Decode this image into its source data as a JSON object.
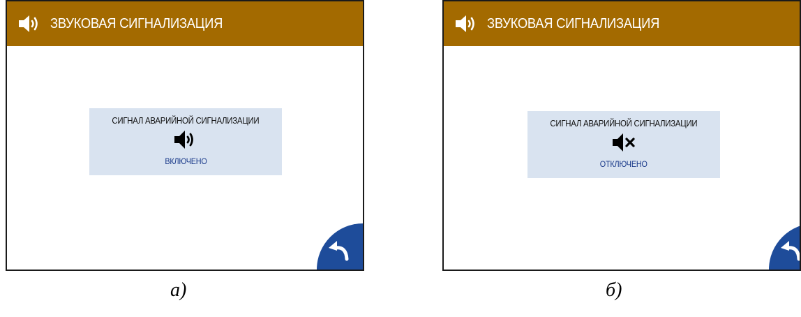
{
  "screens": [
    {
      "header": {
        "title": "ЗВУКОВАЯ СИГНАЛИЗАЦИЯ",
        "icon": "speaker-on-icon"
      },
      "panel": {
        "label": "СИГНАЛ АВАРИЙНОЙ СИГНАЛИЗАЦИИ",
        "icon": "speaker-on-icon",
        "status": "ВКЛЮЧЕНО"
      },
      "back_button": {
        "icon": "back-arrow-icon"
      },
      "caption": "а)"
    },
    {
      "header": {
        "title": "ЗВУКОВАЯ СИГНАЛИЗАЦИЯ",
        "icon": "speaker-on-icon"
      },
      "panel": {
        "label": "СИГНАЛ АВАРИЙНОЙ СИГНАЛИЗАЦИИ",
        "icon": "speaker-muted-icon",
        "status": "ОТКЛЮЧЕНО"
      },
      "back_button": {
        "icon": "back-arrow-icon"
      },
      "caption": "б)"
    }
  ],
  "colors": {
    "header_bg": "#a36a00",
    "panel_bg": "#d9e3f0",
    "status_text": "#1a3a8a",
    "back_button_bg": "#1e4c9a"
  }
}
